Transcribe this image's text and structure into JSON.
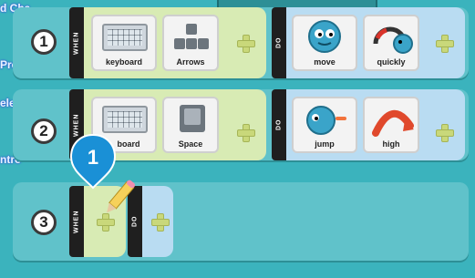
{
  "side_labels": [
    "d Cha",
    "Prev",
    "elete",
    "ntro"
  ],
  "rows": [
    {
      "number": "1",
      "when_label": "WHEN",
      "do_label": "DO",
      "when_tiles": [
        {
          "label": "keyboard",
          "icon": "keyboard-icon"
        },
        {
          "label": "Arrows",
          "icon": "arrow-keys-icon"
        }
      ],
      "do_tiles": [
        {
          "label": "move",
          "icon": "character-move-icon"
        },
        {
          "label": "quickly",
          "icon": "speedometer-icon"
        }
      ]
    },
    {
      "number": "2",
      "when_label": "WHEN",
      "do_label": "DO",
      "when_tiles": [
        {
          "label": "board",
          "icon": "keyboard-icon"
        },
        {
          "label": "Space",
          "icon": "space-key-icon"
        }
      ],
      "do_tiles": [
        {
          "label": "jump",
          "icon": "character-jump-icon"
        },
        {
          "label": "high",
          "icon": "arc-high-icon"
        }
      ]
    },
    {
      "number": "3",
      "when_label": "WHEN",
      "do_label": "DO"
    }
  ],
  "callout": {
    "number": "1",
    "color": "#1a90d6"
  },
  "colors": {
    "background": "#3bb3bd",
    "when_zone": "#d8ebb4",
    "do_zone": "#b9dcf2",
    "plus": "#c9d87a"
  }
}
